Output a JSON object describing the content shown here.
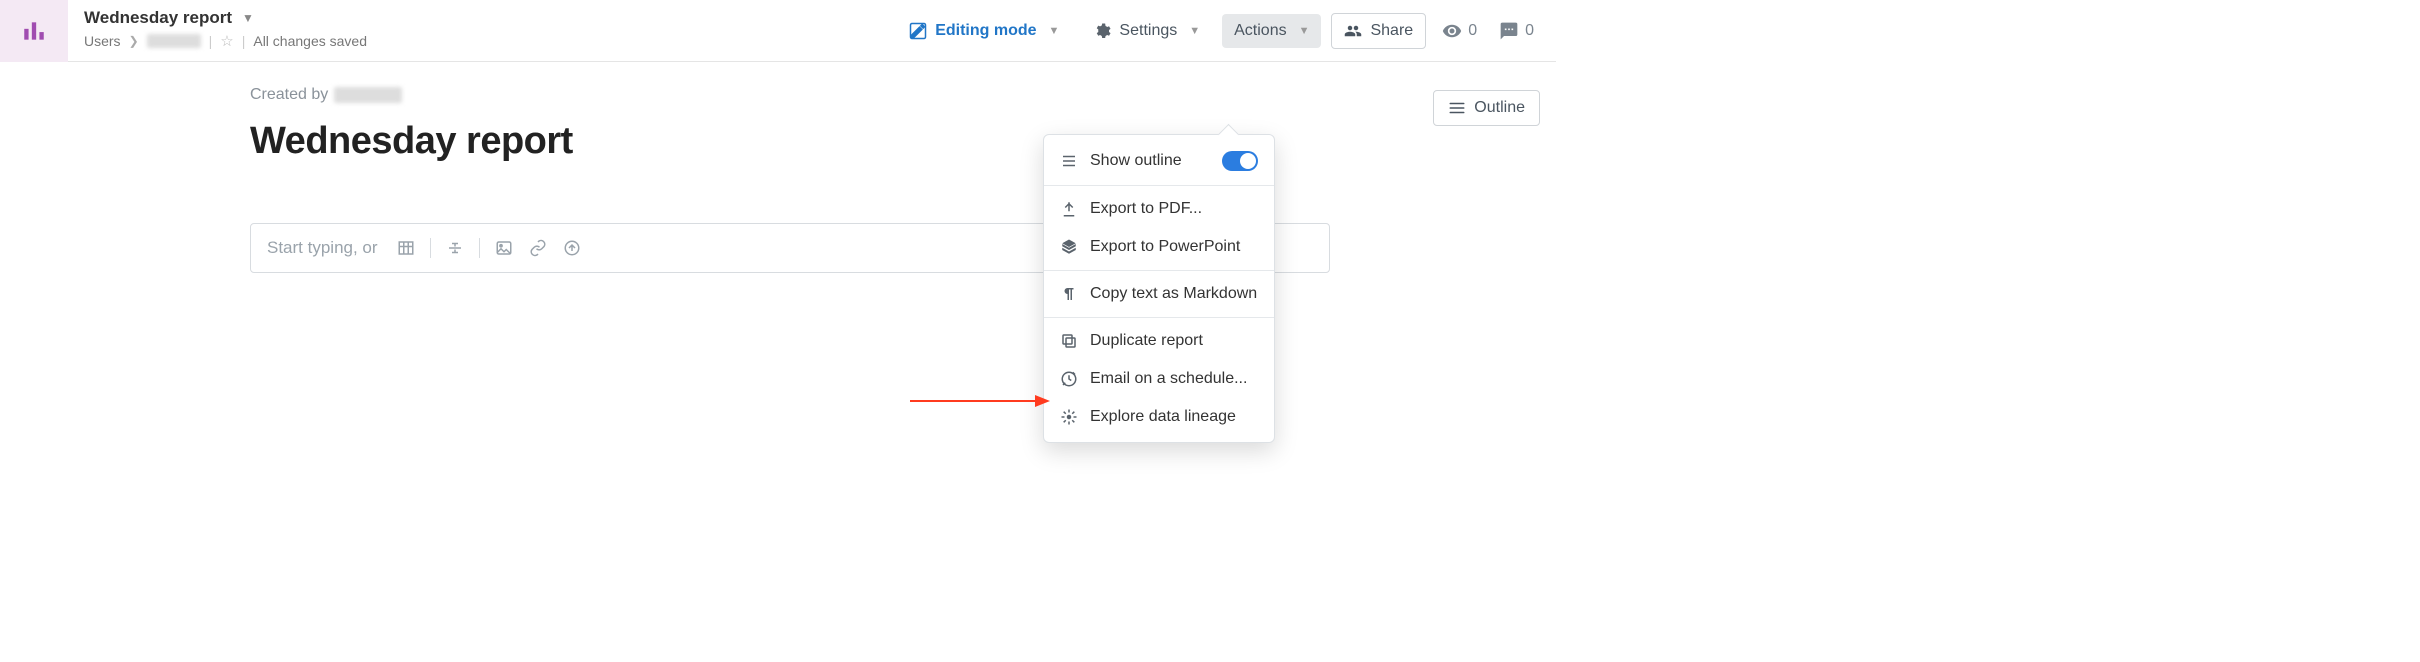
{
  "header": {
    "title": "Wednesday report",
    "breadcrumb_root": "Users",
    "save_status": "All changes saved"
  },
  "toolbar": {
    "editing_mode": "Editing mode",
    "settings": "Settings",
    "actions": "Actions",
    "share": "Share",
    "views_count": "0",
    "comments_count": "0"
  },
  "doc": {
    "created_by_label": "Created by",
    "title": "Wednesday report",
    "placeholder": "Start typing, or"
  },
  "outline_button": "Outline",
  "actions_menu": {
    "show_outline": "Show outline",
    "export_pdf": "Export to PDF...",
    "export_ppt": "Export to PowerPoint",
    "copy_md": "Copy text as Markdown",
    "duplicate": "Duplicate report",
    "email_schedule": "Email on a schedule...",
    "lineage": "Explore data lineage"
  }
}
